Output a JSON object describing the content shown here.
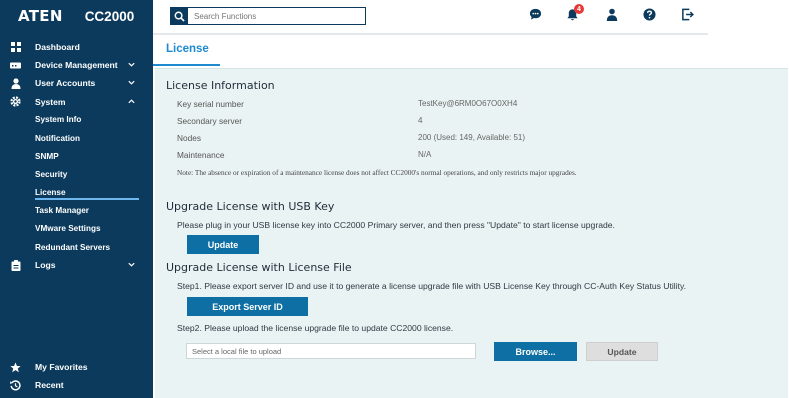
{
  "brand": {
    "logo": "ATEN",
    "model": "CC2000"
  },
  "search": {
    "placeholder": "Search Functions"
  },
  "topbar": {
    "icons": [
      "chat-icon",
      "bell-icon",
      "user-icon",
      "help-icon",
      "logout-icon"
    ],
    "notification_count": "4"
  },
  "sidebar": {
    "dashboard": "Dashboard",
    "device_management": "Device Management",
    "user_accounts": "User Accounts",
    "system": "System",
    "system_children": [
      "System Info",
      "Notification",
      "SNMP",
      "Security",
      "License",
      "Task Manager",
      "VMware Settings",
      "Redundant Servers"
    ],
    "logs": "Logs",
    "favorites": "My Favorites",
    "recent": "Recent"
  },
  "tab": {
    "label": "License"
  },
  "license_info": {
    "heading": "License Information",
    "rows": [
      {
        "key": "Key serial number",
        "value": "TestKey@6RM0O67O0XH4"
      },
      {
        "key": "Secondary server",
        "value": "4"
      },
      {
        "key": "Nodes",
        "value": "200 (Used: 149, Available: 51)"
      },
      {
        "key": "Maintenance",
        "value": "N/A"
      }
    ],
    "note": "Note: The absence or expiration of a maintenance license does not affect CC2000's normal operations, and only restricts major upgrades."
  },
  "usb_upgrade": {
    "heading": "Upgrade License with USB Key",
    "instruction": "Please plug in your USB license key into CC2000 Primary server, and then press \"Update\" to start license upgrade.",
    "button": "Update"
  },
  "file_upgrade": {
    "heading": "Upgrade License with License File",
    "step1": "Step1. Please export server ID and use it to generate a license upgrade file with USB License Key through CC-Auth Key Status Utility.",
    "export_button": "Export Server ID",
    "step2": "Step2. Please upload the license upgrade file to update CC2000 license.",
    "file_placeholder": "Select a local file to upload",
    "browse_button": "Browse...",
    "update_button": "Update"
  },
  "colors": {
    "sidebar": "#0b3a5c",
    "accent": "#1f8ad0",
    "button": "#0d6fa3",
    "panel": "#eaf3f3",
    "badge": "#e53935"
  }
}
